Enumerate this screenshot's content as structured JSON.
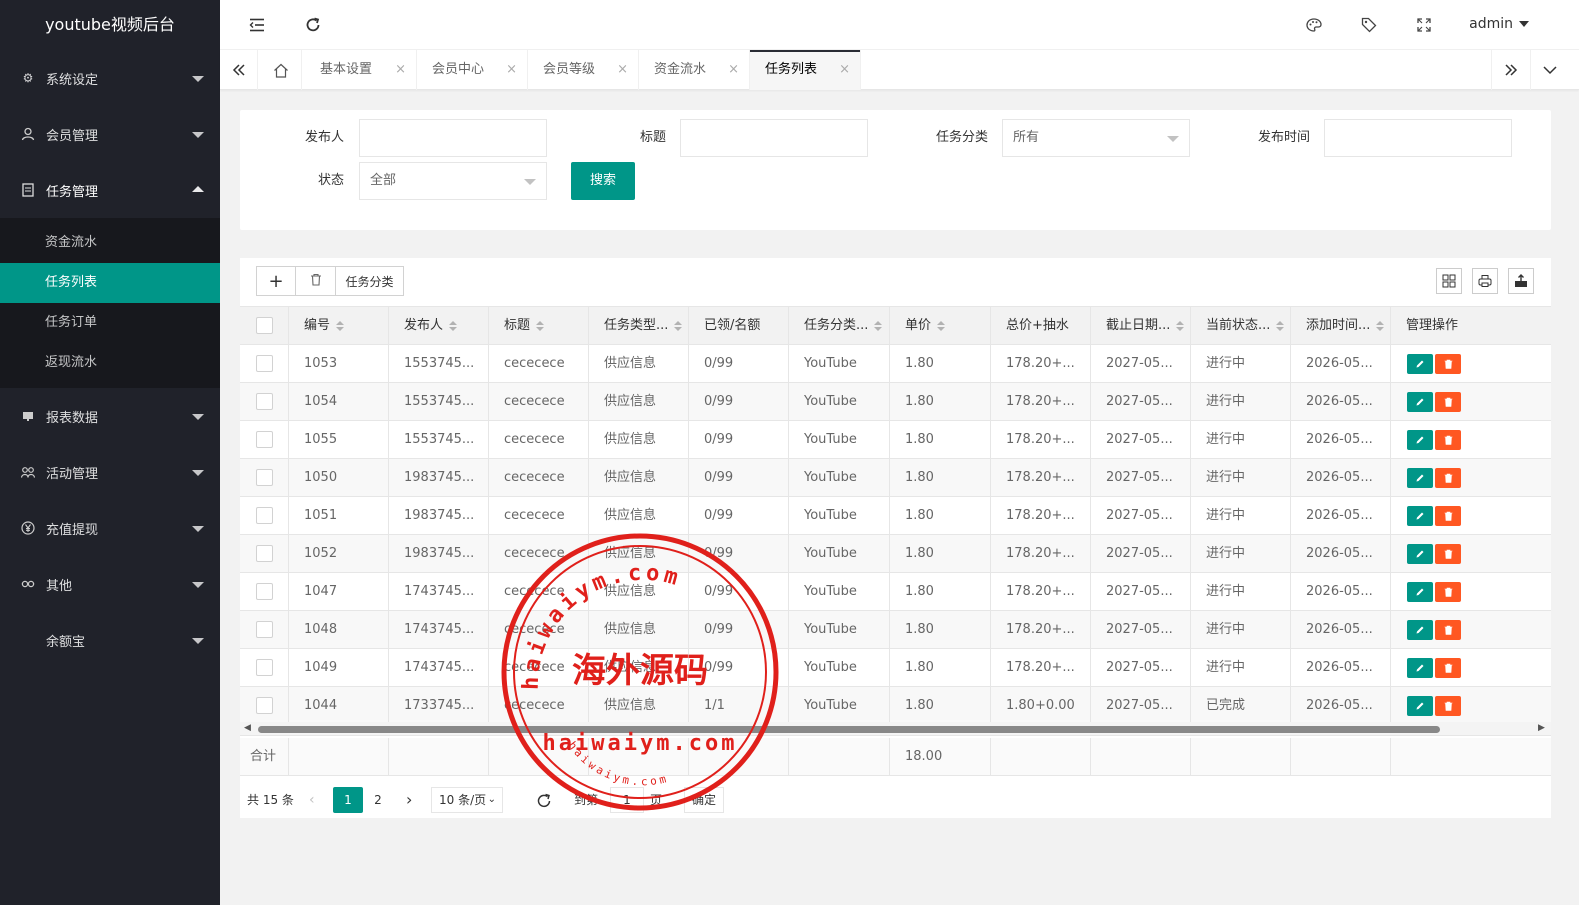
{
  "app": {
    "title": "youtube视频后台"
  },
  "sidebar": {
    "items": [
      {
        "label": "系统设定",
        "icon": "gear-icon"
      },
      {
        "label": "会员管理",
        "icon": "user-icon"
      },
      {
        "label": "任务管理",
        "icon": "document-icon"
      },
      {
        "label": "报表数据",
        "icon": "monitor-icon"
      },
      {
        "label": "活动管理",
        "icon": "group-icon"
      },
      {
        "label": "充值提现",
        "icon": "yen-icon"
      },
      {
        "label": "其他",
        "icon": "link-icon"
      },
      {
        "label": "余额宝",
        "icon": ""
      }
    ],
    "sub_items": [
      "资金流水",
      "任务列表",
      "任务订单",
      "返现流水"
    ]
  },
  "header": {
    "user": "admin"
  },
  "tabs": [
    {
      "label": "基本设置"
    },
    {
      "label": "会员中心"
    },
    {
      "label": "会员等级"
    },
    {
      "label": "资金流水"
    },
    {
      "label": "任务列表"
    }
  ],
  "tab_close": "×",
  "search": {
    "publisher_label": "发布人",
    "publisher_value": "",
    "title_label": "标题",
    "title_value": "",
    "category_label": "任务分类",
    "category_value": "所有",
    "time_label": "发布时间",
    "time_value": "",
    "status_label": "状态",
    "status_value": "全部",
    "search_button": "搜索"
  },
  "toolbar": {
    "add": "+",
    "category_button": "任务分类"
  },
  "table": {
    "columns": [
      "编号",
      "发布人",
      "标题",
      "任务类型...",
      "已领/名额",
      "任务分类...",
      "单价",
      "总价+抽水",
      "截止日期...",
      "当前状态...",
      "添加时间...",
      "管理操作"
    ],
    "rows": [
      [
        "1053",
        "1553745...",
        "cecececе",
        "供应信息",
        "0/99",
        "YouTube",
        "1.80",
        "178.20+...",
        "2027-05...",
        "进行中",
        "2026-05..."
      ],
      [
        "1054",
        "1553745...",
        "cecececе",
        "供应信息",
        "0/99",
        "YouTube",
        "1.80",
        "178.20+...",
        "2027-05...",
        "进行中",
        "2026-05..."
      ],
      [
        "1055",
        "1553745...",
        "cecececе",
        "供应信息",
        "0/99",
        "YouTube",
        "1.80",
        "178.20+...",
        "2027-05...",
        "进行中",
        "2026-05..."
      ],
      [
        "1050",
        "1983745...",
        "cecececе",
        "供应信息",
        "0/99",
        "YouTube",
        "1.80",
        "178.20+...",
        "2027-05...",
        "进行中",
        "2026-05..."
      ],
      [
        "1051",
        "1983745...",
        "cecececе",
        "供应信息",
        "0/99",
        "YouTube",
        "1.80",
        "178.20+...",
        "2027-05...",
        "进行中",
        "2026-05..."
      ],
      [
        "1052",
        "1983745...",
        "cecececе",
        "供应信息",
        "0/99",
        "YouTube",
        "1.80",
        "178.20+...",
        "2027-05...",
        "进行中",
        "2026-05..."
      ],
      [
        "1047",
        "1743745...",
        "cecececе",
        "供应信息",
        "0/99",
        "YouTube",
        "1.80",
        "178.20+...",
        "2027-05...",
        "进行中",
        "2026-05..."
      ],
      [
        "1048",
        "1743745...",
        "cecececе",
        "供应信息",
        "0/99",
        "YouTube",
        "1.80",
        "178.20+...",
        "2027-05...",
        "进行中",
        "2026-05..."
      ],
      [
        "1049",
        "1743745...",
        "cecececе",
        "供应信息",
        "0/99",
        "YouTube",
        "1.80",
        "178.20+...",
        "2027-05...",
        "进行中",
        "2026-05..."
      ],
      [
        "1044",
        "1733745...",
        "cecececе",
        "供应信息",
        "1/1",
        "YouTube",
        "1.80",
        "1.80+0.00",
        "2027-05...",
        "已完成",
        "2026-05..."
      ]
    ],
    "total_label": "合计",
    "total_value": "18.00"
  },
  "pager": {
    "total": "共 15 条",
    "pages": [
      "1",
      "2"
    ],
    "per_page": "10 条/页",
    "goto_label": "到第",
    "goto_value": "1",
    "page_unit": "页",
    "confirm": "确定"
  },
  "watermark": {
    "top_text": "haiwaiym.com",
    "center_text": "海外源码",
    "bottom_text": "haiwaiym.com",
    "small_text": "haiwaiym.com",
    "color": "#e0201b"
  },
  "colors": {
    "accent": "#009688",
    "danger": "#ff5722",
    "sidebar": "#20222a"
  }
}
